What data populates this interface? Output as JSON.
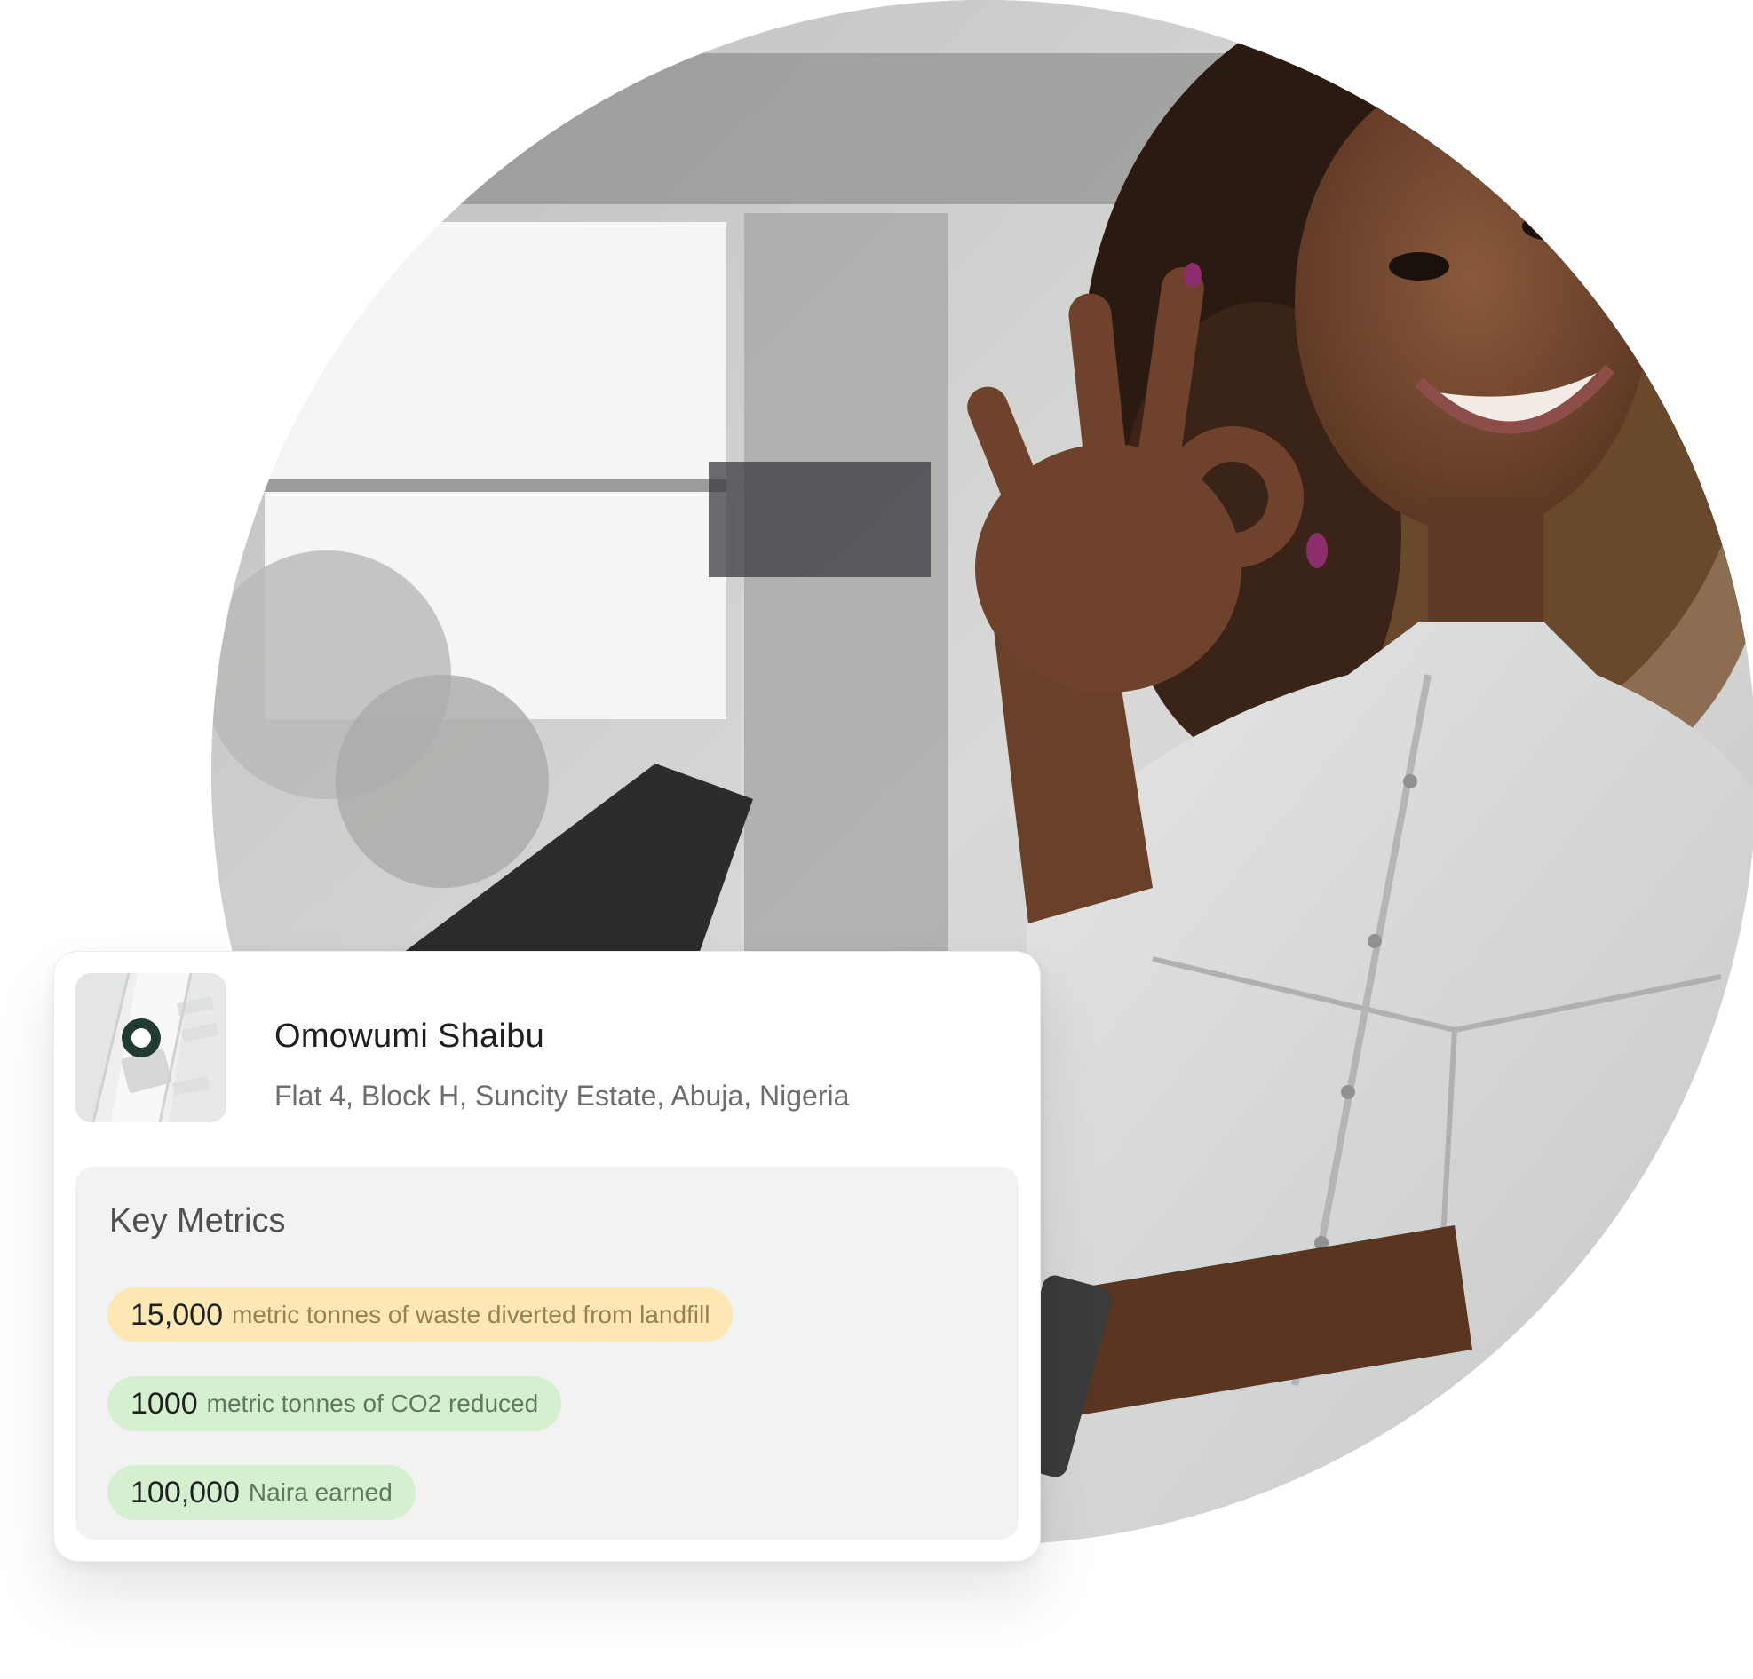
{
  "profile": {
    "name": "Omowumi Shaibu",
    "address": "Flat 4, Block H, Suncity Estate, Abuja, Nigeria"
  },
  "metrics": {
    "title": "Key Metrics",
    "items": [
      {
        "value": "15,000",
        "label": "metric tonnes of waste diverted from landfill",
        "color": "#fde8b3"
      },
      {
        "value": "1000",
        "label": "metric tonnes of  CO2 reduced",
        "color": "#d5f0cf"
      },
      {
        "value": "100,000",
        "label": "Naira earned",
        "color": "#d5f0cf"
      }
    ]
  },
  "colors": {
    "map_pin": "#1f3b33",
    "pill_yellow": "#fde8b3",
    "pill_green": "#d5f0cf"
  },
  "icons": {
    "map_pin": "location-pin-icon"
  }
}
